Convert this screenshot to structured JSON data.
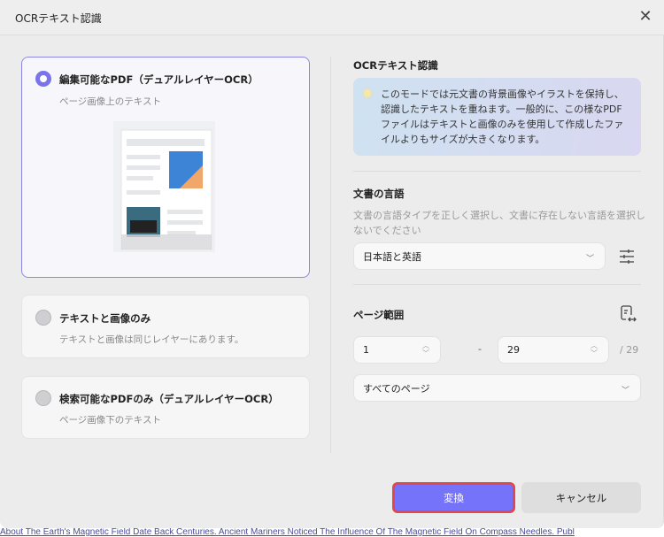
{
  "dialog": {
    "title": "OCRテキスト認識",
    "close_icon": "close-icon"
  },
  "options": [
    {
      "title": "編集可能なPDF（デュアルレイヤーOCR）",
      "subtitle": "ページ画像上のテキスト",
      "selected": true
    },
    {
      "title": "テキストと画像のみ",
      "subtitle": "テキストと画像は同じレイヤーにあります。",
      "selected": false
    },
    {
      "title": "検索可能なPDFのみ（デュアルレイヤーOCR）",
      "subtitle": "ページ画像下のテキスト",
      "selected": false
    }
  ],
  "right": {
    "heading": "OCRテキスト認識",
    "info": "このモードでは元文書の背景画像やイラストを保持し、認識したテキストを重ねます。一般的に、この様なPDFファイルはテキストと画像のみを使用して作成したファイルよりもサイズが大きくなります。",
    "language": {
      "label": "文書の言語",
      "description": "文書の言語タイプを正しく選択し、文書に存在しない言語を選択しないでください",
      "value": "日本語と英語"
    },
    "page_range": {
      "label": "ページ範囲",
      "from": "1",
      "to": "29",
      "total": "/ 29",
      "separator": "-",
      "preset": "すべてのページ"
    }
  },
  "buttons": {
    "convert": "変換",
    "cancel": "キャンセル"
  },
  "background_text": "About The Earth's Magnetic Field Date Back Centuries. Ancient Mariners Noticed The Influence Of The Magnetic Field On Compass Needles. Publ"
}
